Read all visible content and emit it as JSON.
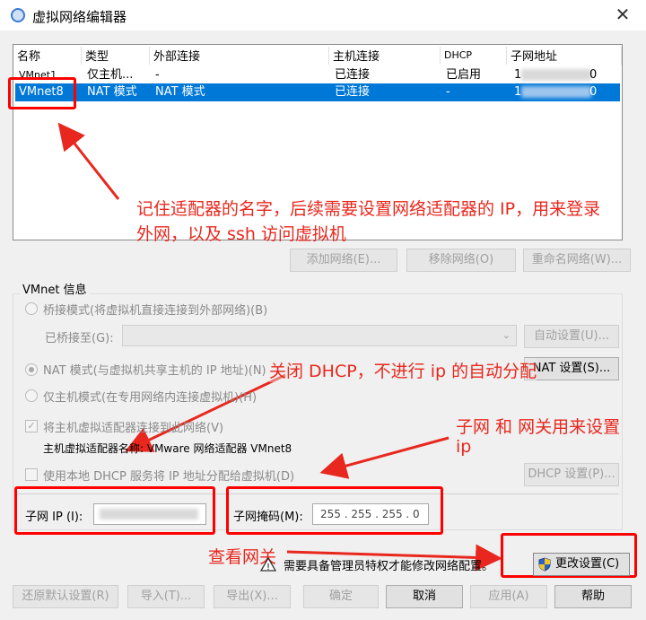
{
  "window": {
    "title": "虚拟网络编辑器",
    "close_glyph": "✕"
  },
  "table": {
    "headers": [
      "名称",
      "类型",
      "外部连接",
      "主机连接",
      "DHCP",
      "子网地址"
    ],
    "rows": [
      {
        "name": "VMnet1",
        "type": "仅主机...",
        "external": "-",
        "host": "已连接",
        "dhcp": "已启用",
        "subnet": "1"
      },
      {
        "name": "VMnet8",
        "type": "NAT 模式",
        "external": "NAT 模式",
        "host": "已连接",
        "dhcp": "-",
        "subnet": "1"
      }
    ]
  },
  "network_buttons": {
    "add": "添加网络(E)...",
    "remove": "移除网络(O)",
    "rename": "重命名网络(W)..."
  },
  "vmnet_info": {
    "label": "VMnet 信息",
    "bridged": "桥接模式(将虚拟机直接连接到外部网络)(B)",
    "bridged_to_label": "已桥接至(G):",
    "auto_settings": "自动设置(U)...",
    "nat": "NAT 模式(与虚拟机共享主机的 IP 地址)(N)",
    "nat_settings": "NAT 设置(S)...",
    "host_only": "仅主机模式(在专用网络内连接虚拟机)(H)",
    "connect_adapter": "将主机虚拟适配器连接到此网络(V)",
    "adapter_name": "主机虚拟适配器名称: VMware 网络适配器 VMnet8",
    "use_dhcp": "使用本地 DHCP 服务将 IP 地址分配给虚拟机(D)",
    "dhcp_settings": "DHCP 设置(P)...",
    "subnet_ip_label": "子网 IP (I):",
    "subnet_mask_label": "子网掩码(M):",
    "subnet_mask_value": "255 . 255 . 255 .  0"
  },
  "admin": {
    "warning": "需要具备管理员特权才能修改网络配置。",
    "change_settings": "更改设置(C)"
  },
  "bottom_buttons": {
    "restore": "还原默认设置(R)",
    "import": "导入(T)...",
    "export": "导出(X)...",
    "ok": "确定",
    "cancel": "取消",
    "apply": "应用(A)",
    "help": "帮助"
  },
  "annotations": {
    "adapter_note_1": "记住适配器的名字，后续需要设置网络适配器的 IP，用来登录",
    "adapter_note_2": "外网，以及 ssh 访问虚拟机",
    "dhcp_note": "关闭 DHCP，不进行 ip 的自动分配",
    "subnet_note_1": "子网 和 网关用来设置",
    "subnet_note_2": "ip",
    "gateway_note": "查看网关"
  }
}
